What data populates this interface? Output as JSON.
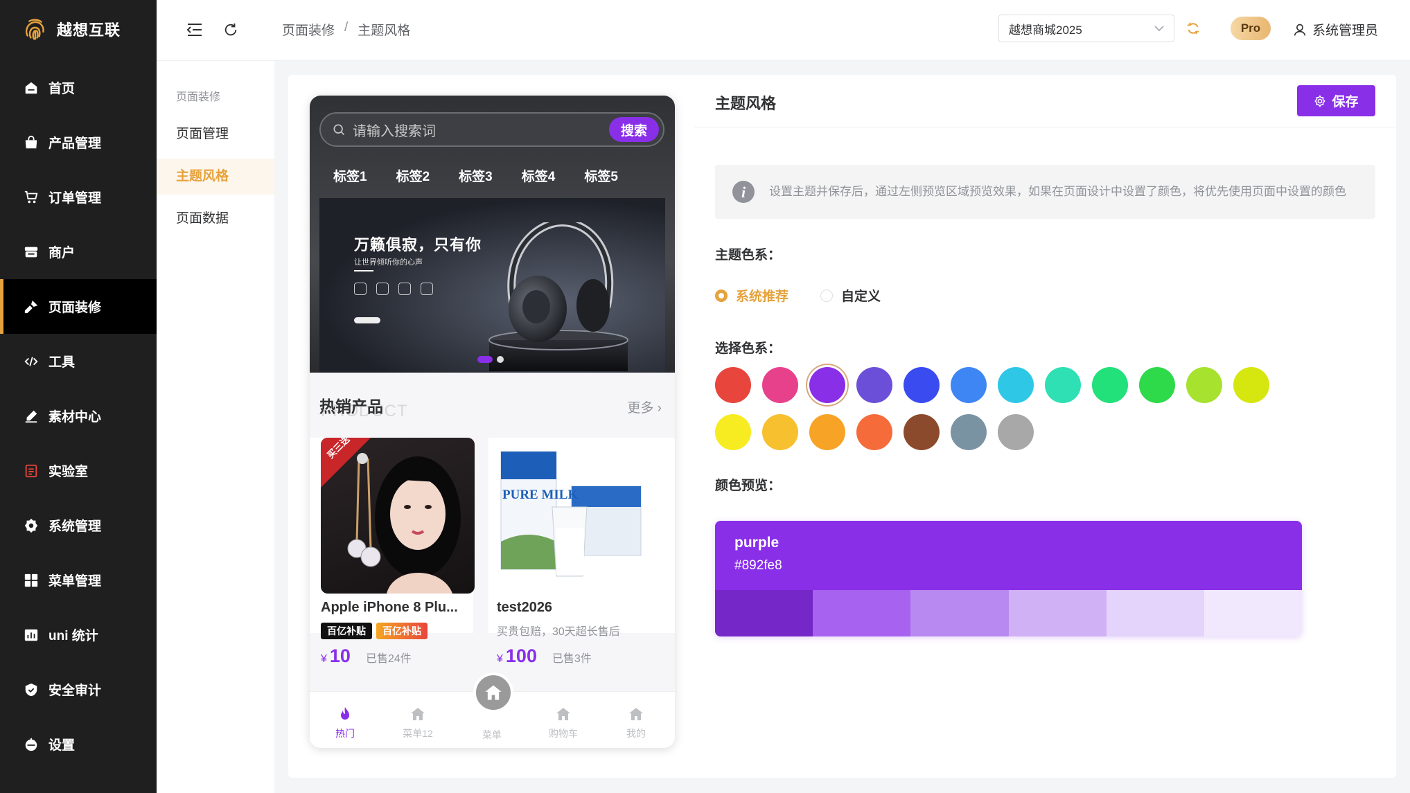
{
  "app": {
    "brand": "越想互联",
    "accent": "#e6a23c"
  },
  "sidebar": {
    "items": [
      {
        "label": "首页",
        "icon": "home-icon"
      },
      {
        "label": "产品管理",
        "icon": "bag-icon"
      },
      {
        "label": "订单管理",
        "icon": "cart-icon"
      },
      {
        "label": "商户",
        "icon": "store-icon"
      },
      {
        "label": "页面装修",
        "icon": "brush-icon",
        "active": true
      },
      {
        "label": "工具",
        "icon": "code-icon"
      },
      {
        "label": "素材中心",
        "icon": "pen-icon"
      },
      {
        "label": "实验室",
        "icon": "document-icon"
      },
      {
        "label": "系统管理",
        "icon": "gear-icon"
      },
      {
        "label": "菜单管理",
        "icon": "grid-icon"
      },
      {
        "label": "uni 统计",
        "icon": "chart-icon"
      },
      {
        "label": "安全审计",
        "icon": "shield-icon"
      },
      {
        "label": "设置",
        "icon": "settings-icon"
      }
    ]
  },
  "header": {
    "breadcrumb": [
      "页面装修",
      "主题风格"
    ],
    "shop_select": "越想商城2025",
    "pro_badge": "Pro",
    "user_name": "系统管理员"
  },
  "subnav": {
    "title": "页面装修",
    "items": [
      {
        "label": "页面管理"
      },
      {
        "label": "主题风格",
        "active": true
      },
      {
        "label": "页面数据"
      }
    ]
  },
  "phone": {
    "search_placeholder": "请输入搜索词",
    "search_button": "搜索",
    "tabs": [
      "标签1",
      "标签2",
      "标签3",
      "标签4",
      "标签5"
    ],
    "banner": {
      "title": "万籁俱寂，只有你",
      "subtitle": "让世界倾听你的心声"
    },
    "hot": {
      "title": "热销产品",
      "bg_text": "PRODUCT",
      "more": "更多"
    },
    "products": [
      {
        "name": "Apple iPhone 8 Plu...",
        "tags": [
          "百亿补贴",
          "百亿补贴"
        ],
        "price": "10",
        "sold": "已售24件",
        "ribbon": "买三送"
      },
      {
        "name": "test2026",
        "desc": "买贵包赔，30天超长售后",
        "price": "100",
        "sold": "已售3件",
        "pack_text": "PURE MILK"
      }
    ],
    "currency": "¥",
    "tabbar": [
      "热门",
      "菜单12",
      "菜单",
      "购物车",
      "我的"
    ]
  },
  "panel": {
    "title": "主题风格",
    "save_label": "保存",
    "notice": "设置主题并保存后，通过左侧预览区域预览效果，如果在页面设计中设置了颜色，将优先使用页面中设置的颜色",
    "scheme_label": "主题色系：",
    "scheme_options": [
      {
        "label": "系统推荐",
        "checked": true
      },
      {
        "label": "自定义",
        "checked": false
      }
    ],
    "palette_label": "选择色系：",
    "palette": [
      "#e8453c",
      "#e8418c",
      "#892fe8",
      "#6b4fd8",
      "#3a4cf0",
      "#3f86f5",
      "#2ec8e6",
      "#2ee0b4",
      "#22e07a",
      "#2ed94a",
      "#a6e22e",
      "#d6e60f",
      "#f7ec22",
      "#f6c02e",
      "#f7a325",
      "#f56b3a",
      "#8b4a2b",
      "#7a93a3",
      "#a8a8a8"
    ],
    "selected_index": 2,
    "preview_label": "颜色预览：",
    "preview": {
      "name": "purple",
      "hex": "#892fe8",
      "shades": [
        "#7527c7",
        "#a762f0",
        "#b989f2",
        "#d0b1f6",
        "#e4d3fa",
        "#f1e8fd"
      ]
    }
  }
}
